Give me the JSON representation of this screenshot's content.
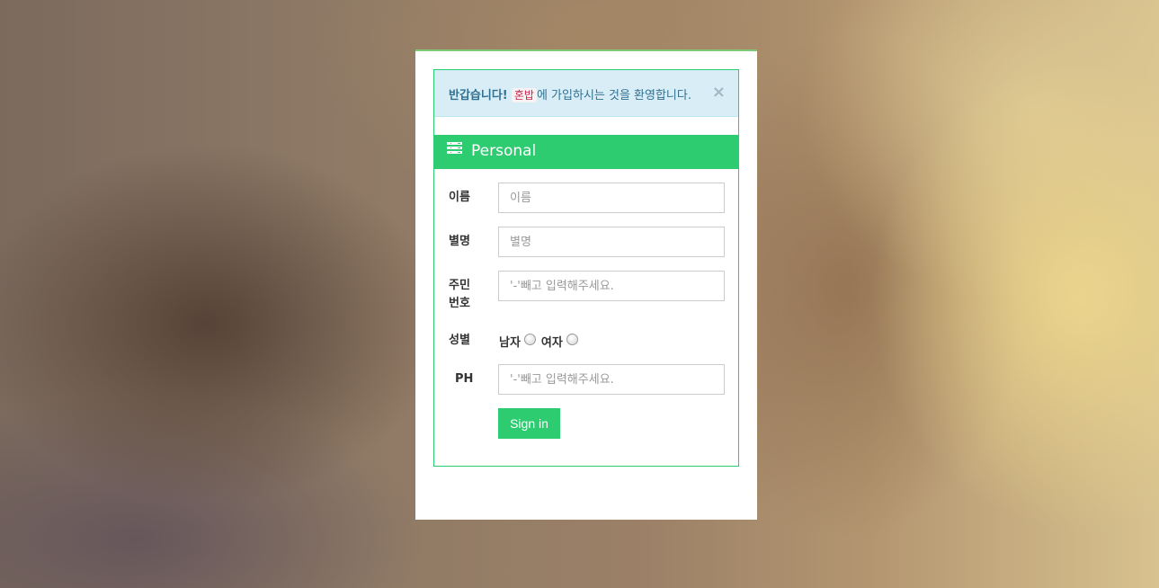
{
  "alert": {
    "strong": "반갑습니다!",
    "code": "혼밥",
    "text": "에 가입하시는 것을 환영합니다.",
    "close": "×"
  },
  "panel": {
    "title": "Personal",
    "icon": "list-icon"
  },
  "form": {
    "name_label": "이름",
    "name_placeholder": "이름",
    "nickname_label": "별명",
    "nickname_placeholder": "별명",
    "rrn_label_line1": "주민",
    "rrn_label_line2": "번호",
    "rrn_placeholder": "'-'빼고 입력해주세요.",
    "gender_label": "성별",
    "gender_male": "남자",
    "gender_female": "여자",
    "phone_label": "PH",
    "phone_placeholder": "'-'빼고 입력해주세요.",
    "submit_label": "Sign in"
  },
  "colors": {
    "accent": "#2ecc71",
    "alert_bg": "#d9edf7",
    "alert_text": "#31708f"
  }
}
